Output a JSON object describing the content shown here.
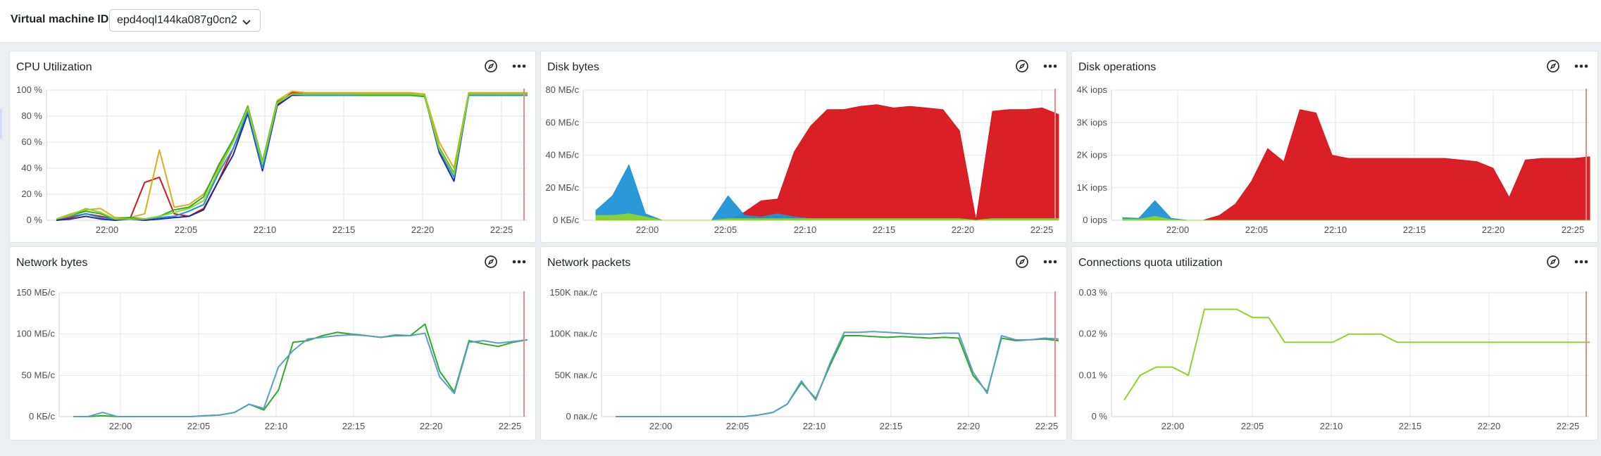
{
  "header": {
    "vm_label": "Virtual machine ID",
    "vm_id": "epd4oql144ka087g0cn2"
  },
  "panel_actions": {
    "explore_icon": "compass-icon",
    "more_icon": "ellipsis-icon"
  },
  "colors": {
    "red": "#d8141a",
    "blue": "#1f93d8",
    "yellow_green": "#8cd42c",
    "green": "#2aab2a",
    "mustard": "#d6b019",
    "navy": "#1d2c9e",
    "steel": "#5b9fc7",
    "now_marker": "#f08a8a"
  },
  "chart_data": [
    {
      "id": "cpu",
      "type": "line",
      "title": "CPU Utilization",
      "x_ticks": [
        "22:00",
        "22:05",
        "22:10",
        "22:15",
        "22:20",
        "22:25"
      ],
      "x": [
        0,
        1,
        2,
        3,
        4,
        5,
        6,
        7,
        8,
        9,
        10,
        11,
        12,
        13,
        14,
        15,
        16,
        17,
        18,
        19,
        20,
        21,
        22,
        23,
        24,
        25,
        26,
        27,
        28,
        29
      ],
      "x_tick_positions": [
        3,
        8,
        13,
        18,
        23,
        28
      ],
      "y_ticks": [
        "0 %",
        "20 %",
        "40 %",
        "60 %",
        "80 %",
        "100 %"
      ],
      "ylim": [
        0,
        100
      ],
      "series": [
        {
          "color": "#d8141a",
          "values": [
            0,
            2,
            5,
            3,
            1,
            1,
            29,
            33,
            5,
            3,
            9,
            30,
            55,
            82,
            40,
            89,
            98,
            97,
            97,
            97,
            97,
            97,
            97,
            97,
            97,
            97,
            55,
            35,
            97,
            97,
            97,
            97,
            97
          ]
        },
        {
          "color": "#d6b019",
          "values": [
            1,
            5,
            8,
            9,
            2,
            2,
            5,
            54,
            10,
            12,
            20,
            40,
            60,
            88,
            45,
            92,
            99,
            98,
            98,
            98,
            98,
            98,
            98,
            98,
            98,
            97,
            60,
            40,
            98,
            98,
            98,
            98,
            98
          ]
        },
        {
          "color": "#1d2c9e",
          "values": [
            0,
            1,
            3,
            1,
            0,
            1,
            0,
            1,
            2,
            3,
            8,
            30,
            50,
            82,
            38,
            88,
            96,
            96,
            96,
            96,
            96,
            96,
            96,
            96,
            96,
            96,
            52,
            30,
            96,
            96,
            96,
            96,
            96
          ]
        },
        {
          "color": "#1f93d8",
          "values": [
            1,
            3,
            5,
            2,
            1,
            2,
            1,
            2,
            3,
            7,
            12,
            36,
            55,
            84,
            40,
            90,
            97,
            96,
            96,
            96,
            96,
            96,
            96,
            96,
            96,
            96,
            54,
            33,
            96,
            96,
            96,
            96,
            96
          ]
        },
        {
          "color": "#2aab2a",
          "values": [
            1,
            4,
            7,
            5,
            1,
            2,
            1,
            3,
            8,
            10,
            18,
            42,
            62,
            87,
            45,
            91,
            97,
            97,
            97,
            97,
            97,
            96,
            96,
            96,
            96,
            95,
            56,
            36,
            97,
            97,
            97,
            97,
            97
          ]
        },
        {
          "color": "#8cd42c",
          "values": [
            1,
            4,
            9,
            6,
            1,
            1,
            1,
            3,
            6,
            9,
            15,
            38,
            60,
            86,
            44,
            90,
            97,
            97,
            97,
            97,
            97,
            97,
            97,
            97,
            97,
            96,
            55,
            35,
            97,
            97,
            97,
            97,
            97
          ]
        }
      ]
    },
    {
      "id": "disk_bytes",
      "type": "area",
      "title": "Disk bytes",
      "x_ticks": [
        "22:00",
        "22:05",
        "22:10",
        "22:15",
        "22:20",
        "22:25"
      ],
      "y_ticks": [
        "0 КБ/с",
        "20 МБ/с",
        "40 МБ/с",
        "60 МБ/с",
        "80 МБ/с"
      ],
      "ylim": [
        0,
        80
      ],
      "series": [
        {
          "color": "#d8141a",
          "values": [
            0,
            0,
            0,
            0,
            0,
            0,
            0,
            0,
            0,
            5,
            12,
            13,
            42,
            58,
            68,
            68,
            70,
            71,
            69,
            70,
            69,
            68,
            55,
            0,
            67,
            68,
            68,
            69,
            65
          ]
        },
        {
          "color": "#1f93d8",
          "values": [
            6,
            15,
            34,
            4,
            0,
            0,
            0,
            0,
            15,
            3,
            2,
            4,
            2,
            1,
            1,
            1,
            1,
            1,
            1,
            1,
            1,
            1,
            1,
            0,
            1,
            1,
            1,
            1,
            1
          ]
        },
        {
          "color": "#8cd42c",
          "values": [
            3,
            3,
            4,
            2,
            0,
            0,
            0,
            0,
            1,
            1,
            1,
            1,
            1,
            1,
            1,
            1,
            1,
            1,
            1,
            1,
            1,
            1,
            1,
            0,
            1,
            1,
            1,
            1,
            1
          ]
        }
      ]
    },
    {
      "id": "disk_ops",
      "type": "area",
      "title": "Disk operations",
      "x_ticks": [
        "22:00",
        "22:05",
        "22:10",
        "22:15",
        "22:20",
        "22:25"
      ],
      "y_ticks": [
        "0 iops",
        "1K iops",
        "2K iops",
        "3K iops",
        "4K iops"
      ],
      "ylim": [
        0,
        4000
      ],
      "series": [
        {
          "color": "#d8141a",
          "values": [
            0,
            0,
            0,
            0,
            0,
            0,
            150,
            500,
            1200,
            2200,
            1800,
            3400,
            3300,
            2000,
            1900,
            1900,
            1900,
            1900,
            1900,
            1900,
            1900,
            1850,
            1800,
            1600,
            700,
            1850,
            1900,
            1900,
            1900,
            1950
          ]
        },
        {
          "color": "#1f93d8",
          "values": [
            80,
            60,
            600,
            60,
            0,
            0,
            0,
            0,
            0,
            0,
            0,
            0,
            0,
            0,
            0,
            0,
            0,
            0,
            0,
            0,
            0,
            0,
            0,
            0,
            0,
            0,
            0,
            0,
            0,
            0
          ]
        },
        {
          "color": "#8cd42c",
          "values": [
            40,
            30,
            120,
            20,
            0,
            0,
            0,
            0,
            0,
            0,
            0,
            0,
            0,
            0,
            0,
            0,
            0,
            0,
            0,
            0,
            0,
            0,
            0,
            0,
            0,
            0,
            0,
            0,
            0,
            0
          ]
        }
      ]
    },
    {
      "id": "net_bytes",
      "type": "line",
      "title": "Network bytes",
      "x_ticks": [
        "22:00",
        "22:05",
        "22:10",
        "22:15",
        "22:20",
        "22:25"
      ],
      "y_ticks": [
        "0 КБ/с",
        "50 МБ/с",
        "100 МБ/с",
        "150 МБ/с"
      ],
      "ylim": [
        0,
        150
      ],
      "series": [
        {
          "color": "#2aab2a",
          "values": [
            0,
            0,
            1,
            0,
            0,
            0,
            0,
            0,
            0,
            1,
            2,
            5,
            15,
            8,
            32,
            90,
            92,
            98,
            102,
            100,
            98,
            96,
            98,
            98,
            112,
            55,
            30,
            92,
            88,
            85,
            90,
            93
          ]
        },
        {
          "color": "#5b9fc7",
          "values": [
            0,
            0,
            5,
            0,
            0,
            0,
            0,
            0,
            0,
            1,
            2,
            5,
            15,
            10,
            60,
            80,
            94,
            96,
            98,
            99,
            98,
            96,
            99,
            98,
            101,
            48,
            28,
            90,
            92,
            89,
            91,
            93
          ]
        }
      ]
    },
    {
      "id": "net_packets",
      "type": "line",
      "title": "Network packets",
      "x_ticks": [
        "22:00",
        "22:05",
        "22:10",
        "22:15",
        "22:20",
        "22:25"
      ],
      "y_ticks": [
        "0 пак./с",
        "50K пак./с",
        "100K пак./с",
        "150K пак./с"
      ],
      "ylim": [
        0,
        150000
      ],
      "series": [
        {
          "color": "#2aab2a",
          "values": [
            0,
            0,
            0,
            0,
            0,
            0,
            0,
            0,
            0,
            0,
            2000,
            5000,
            15000,
            41000,
            22000,
            62000,
            98000,
            98000,
            97000,
            96000,
            97000,
            96000,
            95000,
            96000,
            95000,
            50000,
            30000,
            95000,
            92000,
            93000,
            94000,
            92000
          ]
        },
        {
          "color": "#5b9fc7",
          "values": [
            0,
            0,
            0,
            0,
            0,
            0,
            0,
            0,
            0,
            0,
            2000,
            5000,
            15000,
            43000,
            20000,
            65000,
            102000,
            102000,
            103000,
            102000,
            101000,
            100000,
            100000,
            101000,
            101000,
            54000,
            28000,
            98000,
            93000,
            93000,
            95000,
            94000
          ]
        }
      ]
    },
    {
      "id": "conn_quota",
      "type": "line",
      "title": "Connections quota utilization",
      "x_ticks": [
        "22:00",
        "22:05",
        "22:10",
        "22:15",
        "22:20",
        "22:25"
      ],
      "y_ticks": [
        "0 %",
        "0.01 %",
        "0.02 %",
        "0.03 %"
      ],
      "ylim": [
        0,
        0.03
      ],
      "series": [
        {
          "color": "#8cd42c",
          "values": [
            0.004,
            0.01,
            0.012,
            0.012,
            0.01,
            0.026,
            0.026,
            0.026,
            0.024,
            0.024,
            0.018,
            0.018,
            0.018,
            0.018,
            0.02,
            0.02,
            0.02,
            0.018,
            0.018,
            0.018,
            0.018,
            0.018,
            0.018,
            0.018,
            0.018,
            0.018,
            0.018,
            0.018,
            0.018,
            0.018
          ]
        }
      ]
    }
  ]
}
